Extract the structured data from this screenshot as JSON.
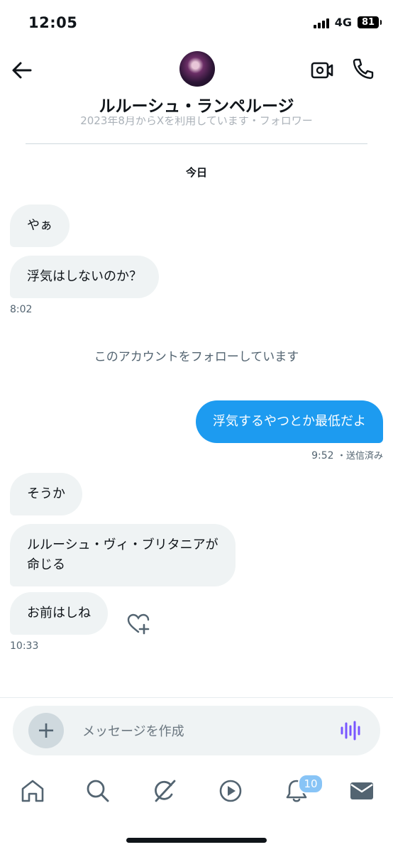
{
  "status_bar": {
    "time": "12:05",
    "network": "4G",
    "battery": "81"
  },
  "header": {
    "contact_name": "ルルーシュ・ランペルージ",
    "faded_info": "2023年8月からXを利用しています・フォロワー"
  },
  "date_separator": "今日",
  "messages": [
    {
      "direction": "in",
      "text": "やぁ"
    },
    {
      "direction": "in",
      "text": "浮気はしないのか？",
      "time": "8:02"
    },
    {
      "direction": "out",
      "text": "浮気するやつとか最低だよ",
      "time": "9:52",
      "status": "・送信済み"
    },
    {
      "direction": "in",
      "text": "そうか"
    },
    {
      "direction": "in",
      "text": "ルルーシュ・ヴィ・ブリタニアが\n命じる"
    },
    {
      "direction": "in",
      "text": "お前はしね",
      "time": "10:33"
    }
  ],
  "system_note": "このアカウントをフォローしています",
  "composer": {
    "placeholder": "メッセージを作成",
    "add_label": "+"
  },
  "tabbar": {
    "notifications_badge": "10"
  },
  "colors": {
    "accent": "#1d9bf0",
    "bubble_in": "#eff3f4",
    "voice": "#7856ff"
  },
  "icons": [
    "back-arrow-icon",
    "video-call-icon",
    "phone-icon",
    "heart-plus-icon",
    "plus-icon",
    "voice-wave-icon",
    "home-icon",
    "search-icon",
    "grok-icon",
    "video-play-icon",
    "bell-icon",
    "mail-icon"
  ]
}
